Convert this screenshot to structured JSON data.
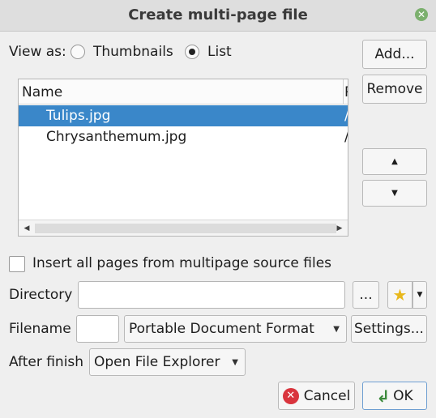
{
  "window": {
    "title": "Create multi-page file",
    "close_symbol": "✕"
  },
  "view": {
    "label": "View as:",
    "options": [
      {
        "label": "Thumbnails",
        "selected": false
      },
      {
        "label": "List",
        "selected": true
      }
    ]
  },
  "side_buttons": {
    "add": "Add...",
    "remove": "Remove",
    "up": "▲",
    "down": "▼"
  },
  "file_list": {
    "columns": [
      "Name",
      "P"
    ],
    "rows": [
      {
        "name": "Tulips.jpg",
        "path": "/",
        "selected": true
      },
      {
        "name": "Chrysanthemum.jpg",
        "path": "/",
        "selected": false
      }
    ],
    "scroll_left": "◀",
    "scroll_right": "▶"
  },
  "insert_pages": {
    "label": "Insert all pages from multipage source files",
    "checked": false
  },
  "directory": {
    "label": "Directory",
    "value": "",
    "browse_label": "...",
    "favorite_icon": "star-icon",
    "favorite_symbol": "★",
    "dropdown_symbol": "▼"
  },
  "filename": {
    "label": "Filename",
    "value": "",
    "format": "Portable Document Format",
    "settings_label": "Settings..."
  },
  "after_finish": {
    "label": "After finish",
    "value": "Open File Explorer"
  },
  "footer": {
    "cancel_label": "Cancel",
    "cancel_symbol": "✕",
    "ok_label": "OK",
    "ok_symbol": "↲"
  },
  "colors": {
    "selection": "#3a87c9",
    "ok_border": "#6f9fd2",
    "cancel_icon": "#d9343d"
  }
}
